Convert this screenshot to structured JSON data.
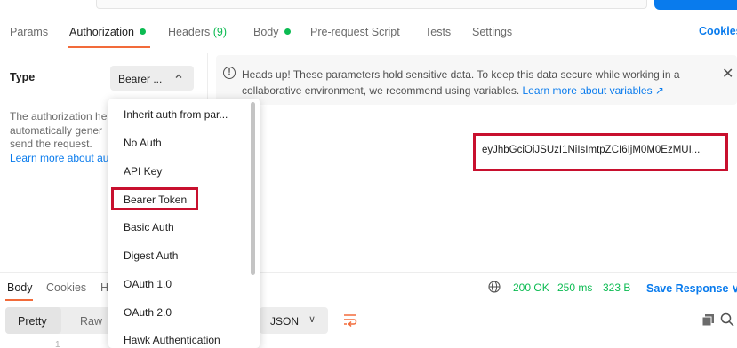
{
  "request_tabs": {
    "params": "Params",
    "authorization": "Authorization",
    "headers": "Headers",
    "headers_count": "(9)",
    "body": "Body",
    "pre_request": "Pre-request Script",
    "tests": "Tests",
    "settings": "Settings",
    "cookies": "Cookies"
  },
  "auth": {
    "type_label": "Type",
    "type_selected": "Bearer ...",
    "description_lines": [
      "The authorization he",
      "automatically gener",
      "send the request.",
      "Learn more about au"
    ]
  },
  "banner": {
    "icon": "info-icon",
    "text": "Heads up! These parameters hold sensitive data. To keep this data secure while working in a collaborative environment, we recommend using variables.",
    "link": "Learn more about variables ↗",
    "close": "✕"
  },
  "token": {
    "value": "eyJhbGciOiJSUzI1NiIsImtpZCI6IjM0M0EzMUI..."
  },
  "auth_menu": {
    "items": [
      "Inherit auth from par...",
      "No Auth",
      "API Key",
      "Bearer Token",
      "Basic Auth",
      "Digest Auth",
      "OAuth 1.0",
      "OAuth 2.0",
      "Hawk Authentication"
    ],
    "highlighted": "Bearer Token"
  },
  "response": {
    "tabs": [
      "Body",
      "Cookies",
      "H"
    ],
    "status": "200 OK",
    "time": "250 ms",
    "size": "323 B",
    "save_label": "Save Response",
    "save_caret": "∨",
    "view_pretty": "Pretty",
    "view_raw": "Raw",
    "format": "JSON",
    "format_caret": "∨",
    "line_number": "1"
  },
  "colors": {
    "accent_orange": "#f26b3a",
    "link_blue": "#097bed",
    "status_green": "#0cbb52",
    "highlight_red": "#c8102e"
  }
}
